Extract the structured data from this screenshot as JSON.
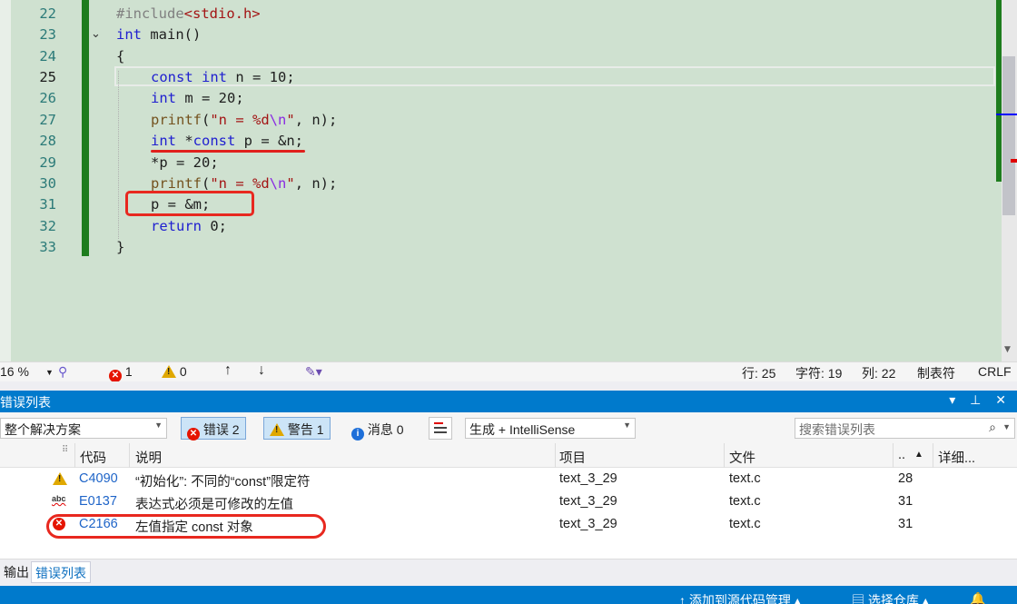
{
  "editor": {
    "lines": [
      {
        "num": "22",
        "cur": false
      },
      {
        "num": "23",
        "cur": false
      },
      {
        "num": "24",
        "cur": false
      },
      {
        "num": "25",
        "cur": true
      },
      {
        "num": "26",
        "cur": false
      },
      {
        "num": "27",
        "cur": false
      },
      {
        "num": "28",
        "cur": false
      },
      {
        "num": "29",
        "cur": false
      },
      {
        "num": "30",
        "cur": false
      },
      {
        "num": "31",
        "cur": false
      },
      {
        "num": "32",
        "cur": false
      },
      {
        "num": "33",
        "cur": false
      }
    ],
    "code": {
      "l22_a": "#include",
      "l22_b": "<stdio.h>",
      "l23_kw": "int",
      "l23_rest": " main()",
      "l24": "{",
      "l25_kw1": "const",
      "l25_kw2": "int",
      "l25_rest": " n = 10;",
      "l26_kw": "int",
      "l26_rest": " m = 20;",
      "l27_fn": "printf",
      "l27_open": "(",
      "l27_str": "\"n = %d",
      "l27_esc": "\\n",
      "l27_strend": "\"",
      "l27_rest": ", n);",
      "l28_kw1": "int",
      "l28_mid": " *",
      "l28_kw2": "const",
      "l28_rest": " p = &n;",
      "l29": "*p = 20;",
      "l30_fn": "printf",
      "l30_open": "(",
      "l30_str": "\"n = %d",
      "l30_esc": "\\n",
      "l30_strend": "\"",
      "l30_rest": ", n);",
      "l31": "p = &m;",
      "l32_kw": "return",
      "l32_rest": " 0;",
      "l33": "}"
    },
    "fold_glyph": "⌄"
  },
  "editor_status": {
    "zoom": "16 %",
    "errors": "1",
    "warnings": "0",
    "up_arrow": "↑",
    "down_arrow": "↓",
    "row": "行: 25",
    "char": "字符: 19",
    "col": "列: 22",
    "tabs": "制表符",
    "eol": "CRLF"
  },
  "panel": {
    "title": "错误列表",
    "title_buttons": "▾ ⊥ ✕",
    "scope": "整个解决方案",
    "errors_toggle": "错误 2",
    "warnings_toggle": "警告 1",
    "messages_toggle": "消息 0",
    "build_filter": "生成 + IntelliSense",
    "search_placeholder": "搜索错误列表",
    "search_icon_glyph": "⌕",
    "headers": {
      "code": "代码",
      "description": "说明",
      "project": "项目",
      "file": "文件",
      "line": "..",
      "details": "详细..."
    },
    "rows": [
      {
        "severity": "warning",
        "code": "C4090",
        "description": "“初始化”: 不同的“const”限定符",
        "project": "text_3_29",
        "file": "text.c",
        "line": "28"
      },
      {
        "severity": "intellisense",
        "code": "E0137",
        "description": "表达式必须是可修改的左值",
        "project": "text_3_29",
        "file": "text.c",
        "line": "31"
      },
      {
        "severity": "error",
        "code": "C2166",
        "description": "左值指定 const 对象",
        "project": "text_3_29",
        "file": "text.c",
        "line": "31"
      }
    ],
    "abc_label": "abc"
  },
  "tabs": {
    "output": "输出",
    "error_list": "错误列表"
  },
  "statusbar": {
    "add_source": "↑  添加到源代码管理 ▴",
    "repo": "选择仓库 ▴"
  },
  "colors": {
    "editor_bg": "#cfe1d0",
    "accent": "#007acc",
    "error": "#e51400",
    "warning": "#e0a800",
    "annotation_red": "#e8281f"
  }
}
